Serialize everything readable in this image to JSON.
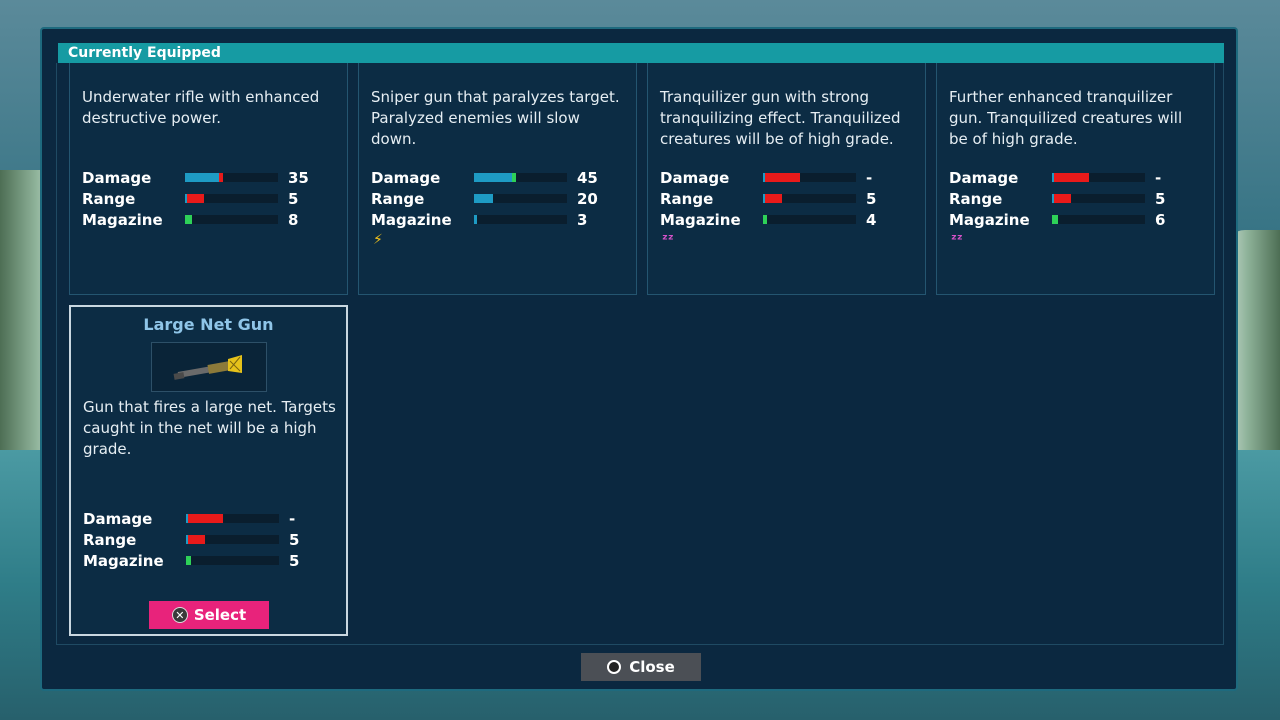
{
  "header": {
    "title": "Currently Equipped"
  },
  "stat_labels": {
    "damage": "Damage",
    "range": "Range",
    "magazine": "Magazine"
  },
  "colors": {
    "stat_blue": "#1e9bc4",
    "stat_red": "#e81a1a",
    "stat_green": "#2ed158",
    "accent_pink": "#e8237b"
  },
  "cards": [
    {
      "desc_lines": [
        "Underwater rifle with enhanced",
        "destructive power."
      ],
      "stats": {
        "damage": {
          "value": "35",
          "fill": 0.41,
          "color": "blue",
          "tip": "red"
        },
        "range": {
          "value": "5",
          "fill": 0.2,
          "color": "red"
        },
        "magazine": {
          "value": "8",
          "fill": 0.08,
          "color": "green"
        }
      },
      "effect_icon": ""
    },
    {
      "desc_lines": [
        "Sniper gun that paralyzes target.",
        "Paralyzed enemies will slow",
        "down."
      ],
      "stats": {
        "damage": {
          "value": "45",
          "fill": 0.45,
          "color": "blue",
          "tip": "green"
        },
        "range": {
          "value": "20",
          "fill": 0.2,
          "color": "blue"
        },
        "magazine": {
          "value": "3",
          "fill": 0.03,
          "color": "blue"
        }
      },
      "effect_icon": "lightning-icon"
    },
    {
      "desc_lines": [
        "Tranquilizer gun with strong",
        "tranquilizing effect. Tranquilized",
        "creatures will be of high grade."
      ],
      "stats": {
        "damage": {
          "value": "-",
          "fill": 0.4,
          "color": "red"
        },
        "range": {
          "value": "5",
          "fill": 0.2,
          "color": "red"
        },
        "magazine": {
          "value": "4",
          "fill": 0.04,
          "color": "green"
        }
      },
      "effect_icon": "sleep-icon"
    },
    {
      "desc_lines": [
        "Further enhanced tranquilizer",
        "gun. Tranquilized creatures will",
        "be of high grade."
      ],
      "stats": {
        "damage": {
          "value": "-",
          "fill": 0.4,
          "color": "red"
        },
        "range": {
          "value": "5",
          "fill": 0.2,
          "color": "red"
        },
        "magazine": {
          "value": "6",
          "fill": 0.06,
          "color": "green"
        }
      },
      "effect_icon": "sleep-icon"
    },
    {
      "name": "Large Net Gun",
      "desc_lines": [
        "Gun that fires a large net. Targets",
        "caught in the net will be a high",
        "grade."
      ],
      "stats": {
        "damage": {
          "value": "-",
          "fill": 0.4,
          "color": "red"
        },
        "range": {
          "value": "5",
          "fill": 0.2,
          "color": "red"
        },
        "magazine": {
          "value": "5",
          "fill": 0.05,
          "color": "green"
        }
      },
      "effect_icon": ""
    }
  ],
  "buttons": {
    "select": "Select",
    "close": "Close"
  },
  "icons": {
    "select_glyph": "✕",
    "close_glyph": "circle"
  }
}
